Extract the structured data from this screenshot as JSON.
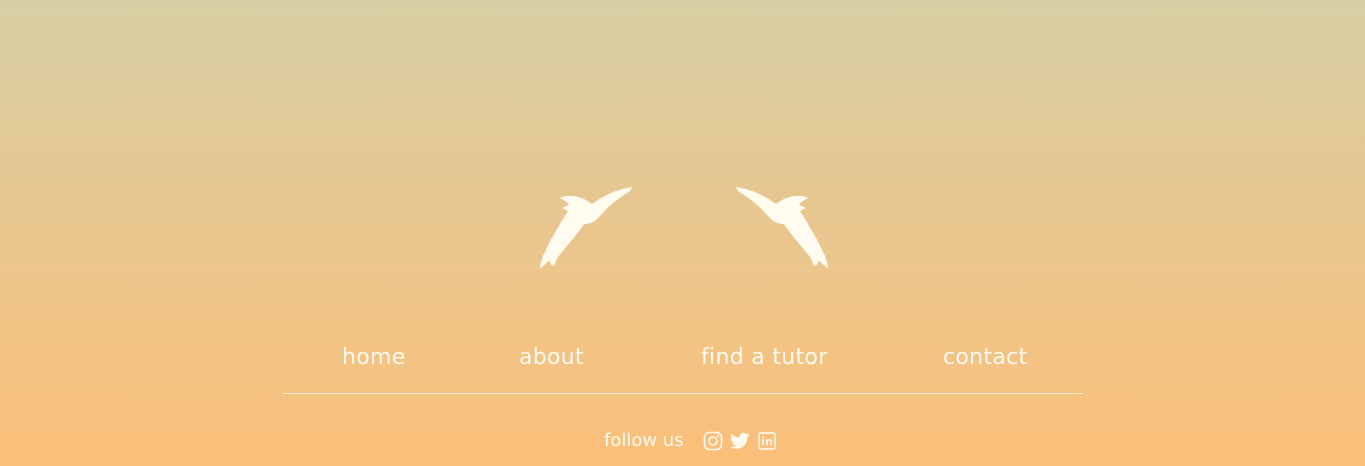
{
  "colors": {
    "gradient_top": "#d8d0a5",
    "gradient_bottom": "#fbbf79",
    "foreground": "#fffaf0"
  },
  "logo": {
    "left_icon": "bird-silhouette-icon",
    "right_icon": "bird-silhouette-icon"
  },
  "nav": {
    "items": [
      {
        "label": "home"
      },
      {
        "label": "about"
      },
      {
        "label": "find a tutor"
      },
      {
        "label": "contact"
      }
    ]
  },
  "social": {
    "label": "follow us",
    "icons": [
      "instagram-icon",
      "twitter-icon",
      "linkedin-icon"
    ]
  }
}
